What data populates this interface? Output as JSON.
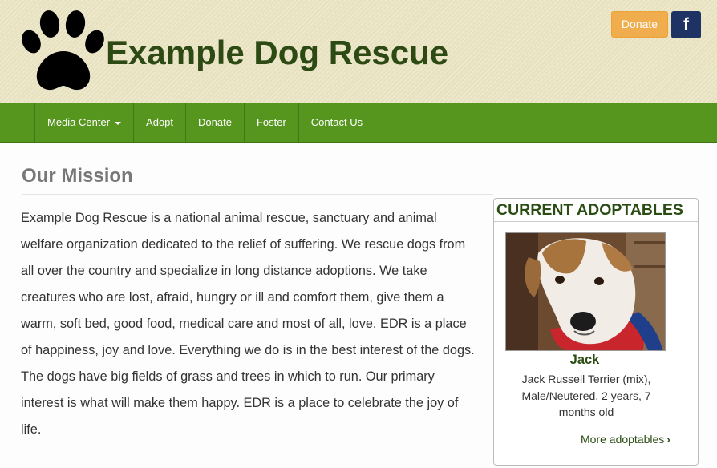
{
  "header": {
    "site_title": "Example Dog Rescue",
    "logo_icon": "paw-print-icon",
    "donate_label": "Donate",
    "facebook_label": "f"
  },
  "colors": {
    "nav_bg": "#56961f",
    "title_green": "#2d4a14",
    "donate_bg": "#f0ad4e",
    "facebook_bg": "#1e3264"
  },
  "nav": {
    "items": [
      {
        "label": "Media Center",
        "has_dropdown": true
      },
      {
        "label": "Adopt"
      },
      {
        "label": "Donate"
      },
      {
        "label": "Foster"
      },
      {
        "label": "Contact Us"
      }
    ]
  },
  "main": {
    "heading": "Our Mission",
    "paragraph": "Example Dog Rescue is a national animal rescue, sanctuary and animal welfare organization dedicated to the relief of suffering. We rescue dogs from all over the country and specialize in long distance adoptions. We take creatures who are lost, afraid, hungry or ill and comfort them, give them a warm, soft bed, good food, medical care and most of all, love. EDR is a place of happiness, joy and love. Everything we do is in the best interest of the dogs. The dogs have big fields of grass and trees in which to run. Our primary interest is what will make them happy. EDR is a place to celebrate the joy of life."
  },
  "adoptables": {
    "heading": "CURRENT ADOPTABLES",
    "dog": {
      "name": "Jack",
      "description": "Jack Russell Terrier (mix), Male/Neutered, 2 years, 7 months old"
    },
    "more_label": "More adoptables",
    "more_icon": "chevron-right-icon"
  }
}
